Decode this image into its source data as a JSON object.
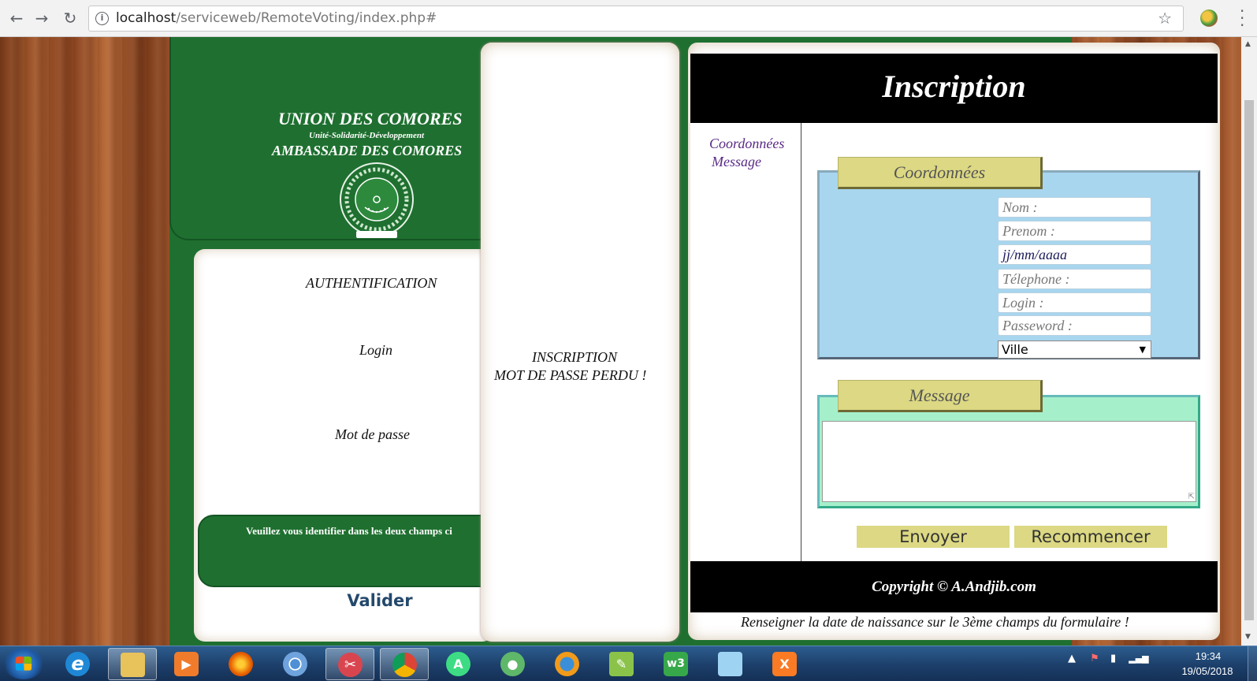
{
  "browser": {
    "url_host": "localhost",
    "url_path": "/serviceweb/RemoteVoting/index.php#",
    "back_icon": "arrow-left-icon",
    "forward_icon": "arrow-right-icon",
    "reload_icon": "reload-icon",
    "bookmark_icon": "star-icon"
  },
  "header": {
    "title": "UNION DES COMORES",
    "subtitle": "Unité-Solidarité-Développement",
    "embassy": "AMBASSADE DES COMORES",
    "seal_icon": "comoros-seal-icon"
  },
  "auth": {
    "title": "AUTHENTIFICATION",
    "login_label": "Login",
    "password_label": "Mot de passe",
    "message": "Veuillez vous identifier dans les deux champs ci",
    "submit_label": "Valider"
  },
  "middle": {
    "inscription_link": "INSCRIPTION",
    "forgot_link": "MOT DE PASSE PERDU !"
  },
  "form": {
    "title": "Inscription",
    "side_links": [
      "Coordonnées",
      "Message"
    ],
    "coord_legend": "Coordonnées",
    "fields": {
      "nom_placeholder": "Nom :",
      "prenom_placeholder": "Prenom :",
      "date_value": "jj/mm/aaaa",
      "telephone_placeholder": "Télephone :",
      "login_placeholder": "Login :",
      "password_placeholder": "Passeword :",
      "city_selected": "Ville"
    },
    "message_legend": "Message",
    "message_value": "",
    "send_label": "Envoyer",
    "reset_label": "Recommencer",
    "copyright": "Copyright © A.Andjib.com",
    "note": "Renseigner la date de naissance sur le 3ème champs du formulaire !"
  },
  "taskbar": {
    "items": [
      "internet-explorer",
      "file-explorer",
      "media-player",
      "firefox",
      "chromium",
      "snipping-tool",
      "chrome",
      "android-studio",
      "maps-app",
      "globe-app",
      "notepad-app",
      "w3-app",
      "notes-app",
      "xampp"
    ],
    "time": "19:34",
    "date": "19/05/2018"
  },
  "colors": {
    "green": "#1f7030",
    "legend_yellow": "#dcd883",
    "coord_blue": "#a8d6ef",
    "message_green": "#a5f0cb"
  }
}
